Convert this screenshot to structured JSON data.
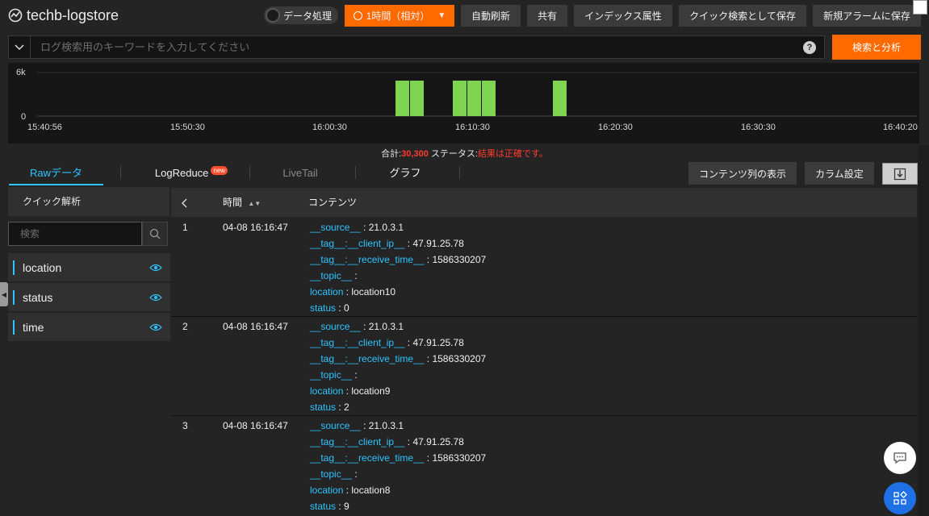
{
  "header": {
    "title": "techb-logstore",
    "data_processing_label": "データ処理",
    "time_range_label": "1時間（相対）",
    "auto_refresh_label": "自動刷新",
    "share_label": "共有",
    "index_attr_label": "インデックス属性",
    "save_quick_search_label": "クイック検索として保存",
    "new_alarm_label": "新規アラームに保存"
  },
  "search": {
    "placeholder": "ログ検索用のキーワードを入力してください",
    "help": "?",
    "submit_label": "検索と分析"
  },
  "histogram": {
    "y_max_label": "6k",
    "y_min_label": "0",
    "x_labels": [
      "15:40:56",
      "15:50:30",
      "16:00:30",
      "16:10:30",
      "16:20:30",
      "16:30:30",
      "16:40:20"
    ],
    "bar_color": "#7ed34f"
  },
  "summary": {
    "total_label": "合計:",
    "total_value": "30,300",
    "status_label": "ステータス:",
    "status_value": "結果は正確です。"
  },
  "tabs": [
    {
      "label": "Rawデータ",
      "active": true
    },
    {
      "label": "LogReduce",
      "badge": "new"
    },
    {
      "label": "LiveTail"
    },
    {
      "label": "グラフ"
    }
  ],
  "toolbar": {
    "show_content_col_label": "コンテンツ列の表示",
    "column_settings_label": "カラム設定"
  },
  "quick_analysis": {
    "title": "クイック解析",
    "filter_placeholder": "検索",
    "fields": [
      "location",
      "status",
      "time"
    ]
  },
  "table": {
    "columns": {
      "time": "時間",
      "content": "コンテンツ"
    },
    "rows": [
      {
        "index": "1",
        "time": "04-08 16:16:47",
        "fields": [
          {
            "key": "__source__",
            "value": "21.0.3.1"
          },
          {
            "key": "__tag__:__client_ip__",
            "value": "47.91.25.78"
          },
          {
            "key": "__tag__:__receive_time__",
            "value": "1586330207"
          },
          {
            "key": "__topic__",
            "value": ""
          },
          {
            "key": "location",
            "value": "location10"
          },
          {
            "key": "status",
            "value": "0"
          }
        ]
      },
      {
        "index": "2",
        "time": "04-08 16:16:47",
        "fields": [
          {
            "key": "__source__",
            "value": "21.0.3.1"
          },
          {
            "key": "__tag__:__client_ip__",
            "value": "47.91.25.78"
          },
          {
            "key": "__tag__:__receive_time__",
            "value": "1586330207"
          },
          {
            "key": "__topic__",
            "value": ""
          },
          {
            "key": "location",
            "value": "location9"
          },
          {
            "key": "status",
            "value": "2"
          }
        ]
      },
      {
        "index": "3",
        "time": "04-08 16:16:47",
        "fields": [
          {
            "key": "__source__",
            "value": "21.0.3.1"
          },
          {
            "key": "__tag__:__client_ip__",
            "value": "47.91.25.78"
          },
          {
            "key": "__tag__:__receive_time__",
            "value": "1586330207"
          },
          {
            "key": "__topic__",
            "value": ""
          },
          {
            "key": "location",
            "value": "location8"
          },
          {
            "key": "status",
            "value": "9"
          }
        ]
      }
    ]
  },
  "colors": {
    "accent": "#ff6a00",
    "link": "#2ec4ff",
    "alert": "#ff3b30"
  }
}
